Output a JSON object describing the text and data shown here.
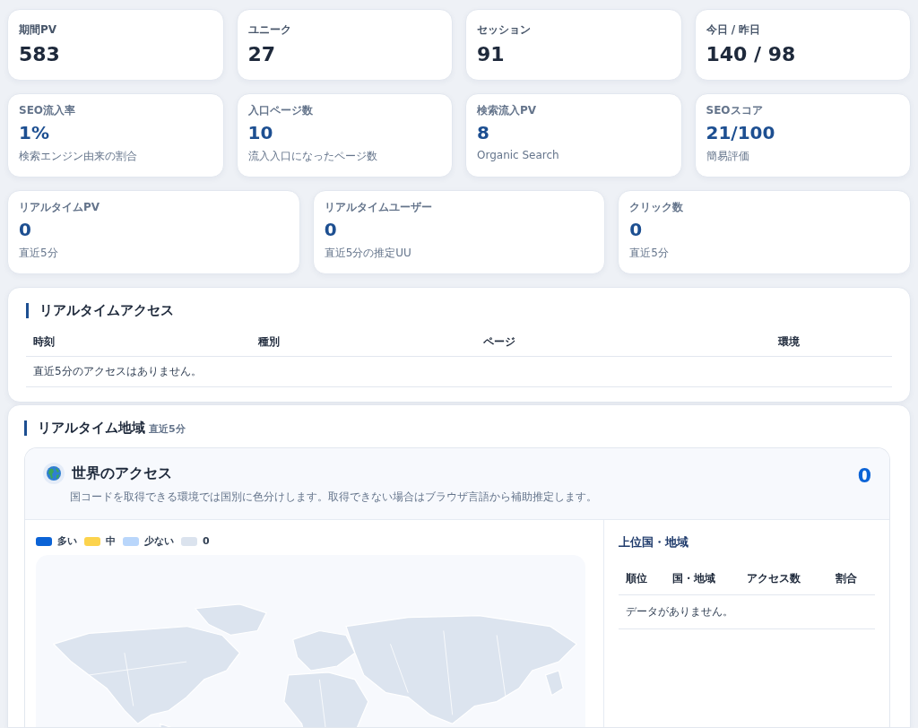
{
  "summary": [
    {
      "label": "期間PV",
      "value": "583"
    },
    {
      "label": "ユニーク",
      "value": "27"
    },
    {
      "label": "セッション",
      "value": "91"
    },
    {
      "label": "今日 / 昨日",
      "value": "140 / 98"
    }
  ],
  "seo": [
    {
      "label": "SEO流入率",
      "value": "1%",
      "note": "検索エンジン由来の割合"
    },
    {
      "label": "入口ページ数",
      "value": "10",
      "note": "流入入口になったページ数"
    },
    {
      "label": "検索流入PV",
      "value": "8",
      "note": "Organic Search"
    },
    {
      "label": "SEOスコア",
      "value": "21/100",
      "note": "簡易評価"
    }
  ],
  "realtime": [
    {
      "label": "リアルタイムPV",
      "value": "0",
      "note": "直近5分"
    },
    {
      "label": "リアルタイムユーザー",
      "value": "0",
      "note": "直近5分の推定UU"
    },
    {
      "label": "クリック数",
      "value": "0",
      "note": "直近5分"
    }
  ],
  "realtime_access": {
    "title": "リアルタイムアクセス",
    "columns": [
      "時刻",
      "種別",
      "ページ",
      "環境"
    ],
    "empty": "直近5分のアクセスはありません。"
  },
  "realtime_region": {
    "title": "リアルタイム地域",
    "subtitle": "直近5分",
    "world": {
      "title": "世界のアクセス",
      "description": "国コードを取得できる環境では国別に色分けします。取得できない場合はブラウザ言語から補助推定します。",
      "total": "0",
      "legend": [
        {
          "label": "多い",
          "color": "#0b63d6"
        },
        {
          "label": "中",
          "color": "#fcd34d"
        },
        {
          "label": "少ない",
          "color": "#b9d6fb"
        },
        {
          "label": "0",
          "color": "#dbe3ee"
        }
      ],
      "ranking": {
        "title": "上位国・地域",
        "columns": [
          "順位",
          "国・地域",
          "アクセス数",
          "割合"
        ],
        "empty": "データがありません。"
      }
    }
  }
}
